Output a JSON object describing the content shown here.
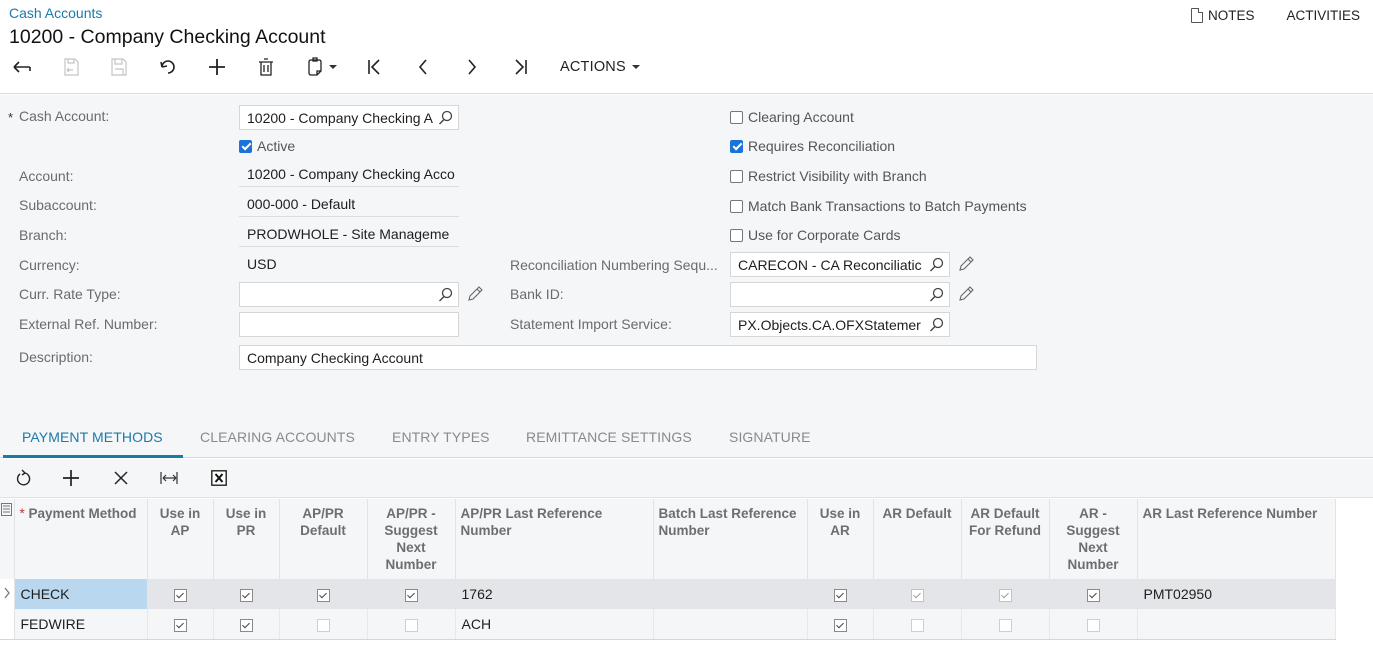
{
  "header": {
    "breadcrumb": "Cash Accounts",
    "title": "10200 - Company Checking Account",
    "notes_label": "NOTES",
    "activities_label": "ACTIVITIES"
  },
  "toolbar": {
    "actions_label": "ACTIONS",
    "icons": [
      "back-icon",
      "save-and-close-icon",
      "save-icon",
      "undo-icon",
      "add-icon",
      "delete-icon",
      "copy-paste-icon",
      "first-record-icon",
      "previous-record-icon",
      "next-record-icon",
      "last-record-icon"
    ]
  },
  "form": {
    "cash_account": {
      "label": "Cash Account:",
      "value": "10200 - Company Checking A"
    },
    "active": {
      "label": "Active",
      "checked": true
    },
    "account": {
      "label": "Account:",
      "value": "10200 - Company Checking Acco"
    },
    "subaccount": {
      "label": "Subaccount:",
      "value": "000-000 - Default"
    },
    "branch": {
      "label": "Branch:",
      "value": "PRODWHOLE - Site Manageme"
    },
    "currency": {
      "label": "Currency:",
      "value": "USD"
    },
    "curr_rate_type": {
      "label": "Curr. Rate Type:",
      "value": ""
    },
    "external_ref": {
      "label": "External Ref. Number:",
      "value": ""
    },
    "description": {
      "label": "Description:",
      "value": "Company Checking Account"
    },
    "recon_numbering": {
      "label": "Reconciliation Numbering Sequ...",
      "value": "CARECON - CA Reconciliatic"
    },
    "bank_id": {
      "label": "Bank ID:",
      "value": ""
    },
    "statement_import": {
      "label": "Statement Import Service:",
      "value": "PX.Objects.CA.OFXStatemer"
    },
    "checkboxes": [
      {
        "label": "Clearing Account",
        "checked": false
      },
      {
        "label": "Requires Reconciliation",
        "checked": true
      },
      {
        "label": "Restrict Visibility with Branch",
        "checked": false
      },
      {
        "label": "Match Bank Transactions to Batch Payments",
        "checked": false
      },
      {
        "label": "Use for Corporate Cards",
        "checked": false
      }
    ]
  },
  "tabs": [
    {
      "label": "PAYMENT METHODS",
      "active": true
    },
    {
      "label": "CLEARING ACCOUNTS",
      "active": false
    },
    {
      "label": "ENTRY TYPES",
      "active": false
    },
    {
      "label": "REMITTANCE SETTINGS",
      "active": false
    },
    {
      "label": "SIGNATURE",
      "active": false
    }
  ],
  "grid_toolbar": {
    "icons": [
      "refresh-icon",
      "add-row-icon",
      "delete-row-icon",
      "fit-columns-icon",
      "export-excel-icon"
    ]
  },
  "grid": {
    "columns": [
      "Payment Method",
      "Use in AP",
      "Use in PR",
      "AP/PR Default",
      "AP/PR - Suggest Next Number",
      "AP/PR Last Reference Number",
      "Batch Last Reference Number",
      "Use in AR",
      "AR Default",
      "AR Default For Refund",
      "AR - Suggest Next Number",
      "AR Last Reference Number"
    ],
    "rows": [
      {
        "payment_method": "CHECK",
        "use_in_ap": true,
        "use_in_pr": true,
        "appr_default": true,
        "appr_suggest_next": true,
        "appr_last_ref": "1762",
        "batch_last_ref": "",
        "use_in_ar": true,
        "ar_default": true,
        "ar_default_refund": true,
        "ar_suggest_next": true,
        "ar_last_ref": "PMT02950"
      },
      {
        "payment_method": "FEDWIRE",
        "use_in_ap": true,
        "use_in_pr": true,
        "appr_default": false,
        "appr_suggest_next": false,
        "appr_last_ref": "ACH",
        "batch_last_ref": "",
        "use_in_ar": true,
        "ar_default": false,
        "ar_default_refund": false,
        "ar_suggest_next": false,
        "ar_last_ref": ""
      }
    ]
  },
  "colors": {
    "accent": "#1a7aa8",
    "checkbox_blue": "#1d72d8",
    "selected_cell": "#b9d7ef",
    "form_bg": "#f5f6f8"
  }
}
